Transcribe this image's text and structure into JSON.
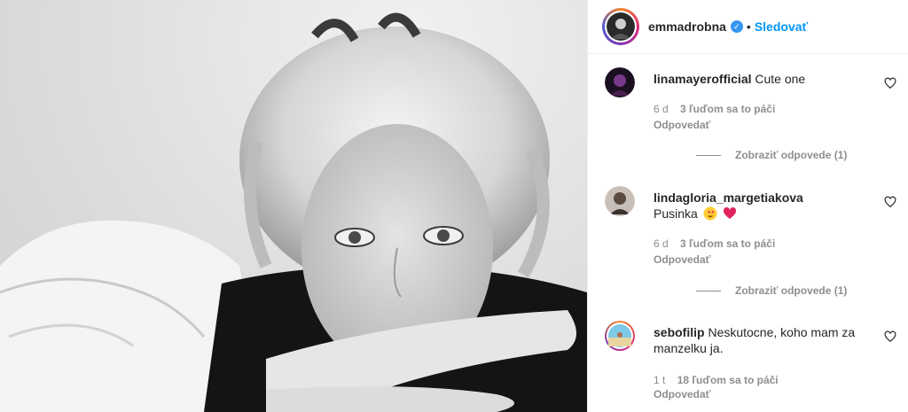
{
  "post": {
    "author": "emmadrobna",
    "separator": "•",
    "follow_label": "Sledovať"
  },
  "comments": [
    {
      "user": "linamayerofficial",
      "text": "Cute one",
      "time": "6 d",
      "likes": "3 ľuďom sa to páči",
      "reply_label": "Odpovedať",
      "view_replies": "Zobraziť odpovede (1)"
    },
    {
      "user": "lindagloria_margetiakova",
      "text": "Pusinka",
      "time": "6 d",
      "likes": "3 ľuďom sa to páči",
      "reply_label": "Odpovedať",
      "view_replies": "Zobraziť odpovede (1)"
    },
    {
      "user": "sebofilip",
      "text": "Neskutocne, koho mam za manzelku ja.",
      "time": "1 t",
      "likes": "18 ľuďom sa to páči",
      "reply_label": "Odpovedať"
    }
  ],
  "icons": {
    "verified": "verified-badge-icon",
    "like": "heart-outline-icon"
  },
  "colors": {
    "follow": "#0095f6",
    "verified": "#3897f0",
    "muted": "#8e8e8e",
    "emoji_heart": "#e0245e"
  }
}
